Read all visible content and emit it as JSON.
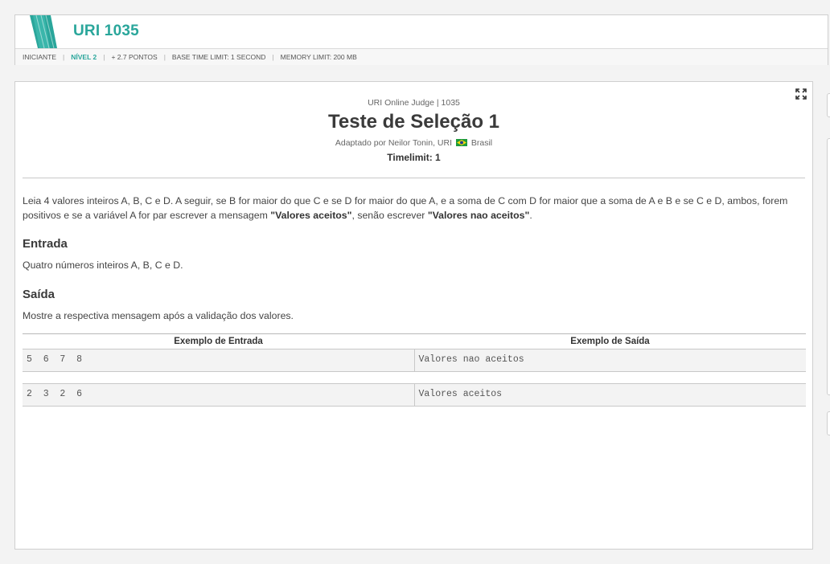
{
  "header": {
    "title": "URI 1035",
    "meta": {
      "category": "INICIANTE",
      "level": "NÍVEL 2",
      "points": "+ 2.7 PONTOS",
      "base_time_limit": "BASE TIME LIMIT: 1 SECOND",
      "memory_limit": "MEMORY LIMIT: 200 MB"
    }
  },
  "problem": {
    "judge": "URI Online Judge | 1035",
    "title": "Teste de Seleção 1",
    "author_prefix": "Adaptado por Neilor Tonin, URI",
    "country": "Brasil",
    "timelimit": "Timelimit: 1",
    "description": {
      "part1": "Leia 4 valores inteiros A, B, C e D. A seguir, se B for maior do que C e se D for maior do que A, e a soma de C com D for maior que a soma de A e B e se C e D, ambos, forem positivos e se a variável A for par escrever a mensagem ",
      "accepted": "\"Valores aceitos\"",
      "part2": ", senão escrever ",
      "rejected": "\"Valores nao aceitos\"",
      "part3": "."
    },
    "input_heading": "Entrada",
    "input_text": "Quatro números inteiros A, B, C e D.",
    "output_heading": "Saída",
    "output_text": "Mostre a respectiva mensagem após a validação dos valores."
  },
  "examples": {
    "input_header": "Exemplo de Entrada",
    "output_header": "Exemplo de Saída",
    "rows": [
      {
        "input": "5 6 7 8",
        "output": "Valores nao aceitos"
      },
      {
        "input": "2 3 2 6",
        "output": "Valores aceitos"
      }
    ]
  },
  "colors": {
    "accent": "#2aa69b",
    "text": "#444444",
    "example_bg": "#f3f3f3"
  },
  "icons": [
    "uri-logo-icon",
    "expand-icon",
    "brazil-flag-icon"
  ]
}
